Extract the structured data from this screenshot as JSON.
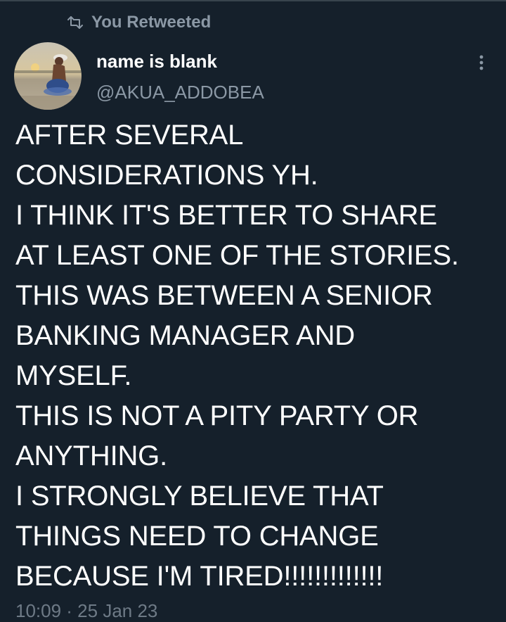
{
  "retweet": {
    "icon": "retweet-icon",
    "label": "You Retweeted"
  },
  "author": {
    "name": "name is blank",
    "handle": "@AKUA_ADDOBEA",
    "avatar": "avatar-image"
  },
  "more_icon": "more-vertical-icon",
  "tweet": {
    "lines": [
      "AFTER SEVERAL",
      "CONSIDERATIONS YH.",
      "I THINK IT'S BETTER TO SHARE",
      "AT LEAST ONE OF THE STORIES.",
      "THIS WAS BETWEEN A SENIOR",
      "BANKING MANAGER AND",
      "MYSELF.",
      "THIS IS NOT A PITY PARTY OR",
      "ANYTHING.",
      "I STRONGLY BELIEVE THAT",
      "THINGS NEED TO CHANGE",
      "BECAUSE I'M TIRED!!!!!!!!!!!!!"
    ],
    "timestamp": "10:09 · 25 Jan 23"
  },
  "colors": {
    "background": "#15202b",
    "primary_text": "#ffffff",
    "secondary_text": "#8b98a5"
  }
}
